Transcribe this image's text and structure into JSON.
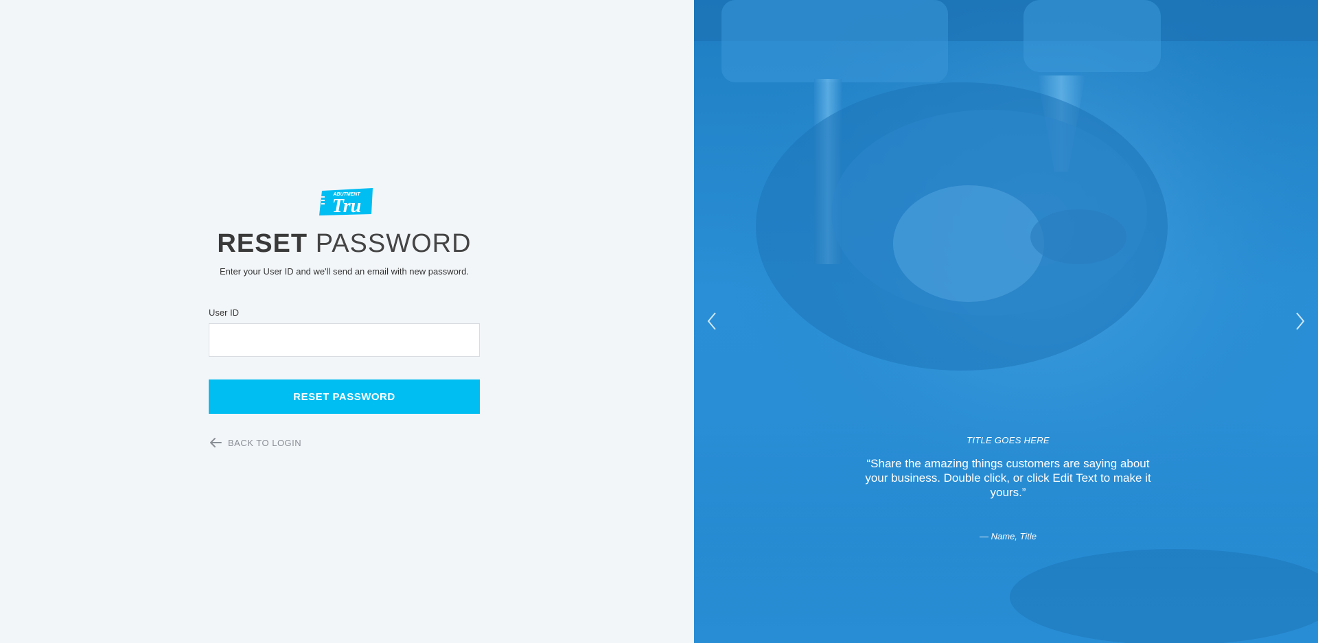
{
  "brand": {
    "logo_small_text": "ABUTMENT",
    "logo_main_text": "Tru",
    "accent_color": "#00bdf2"
  },
  "form": {
    "title_bold": "RESET",
    "title_light": "PASSWORD",
    "subtitle": "Enter your User ID and we'll send an email with new password.",
    "user_id_label": "User ID",
    "user_id_value": "",
    "user_id_placeholder": "",
    "submit_label": "RESET PASSWORD",
    "back_label": "BACK TO LOGIN"
  },
  "testimonial": {
    "title": "TITLE GOES HERE",
    "quote": "“Share the amazing things customers are saying about your business. Double click, or click Edit Text to make it yours.”",
    "author": "—  Name, Title"
  },
  "carousel": {
    "prev_icon": "chevron-left-icon",
    "next_icon": "chevron-right-icon"
  }
}
